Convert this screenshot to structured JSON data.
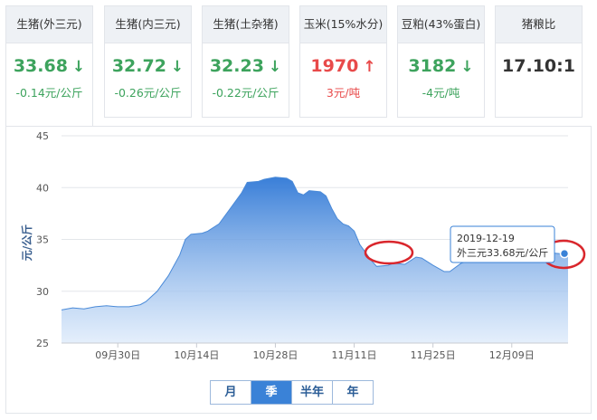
{
  "cards": [
    {
      "title": "生猪(外三元)",
      "value": "33.68",
      "arrow": "↓",
      "change": "-0.14元/公斤",
      "trend": "down"
    },
    {
      "title": "生猪(内三元)",
      "value": "32.72",
      "arrow": "↓",
      "change": "-0.26元/公斤",
      "trend": "down"
    },
    {
      "title": "生猪(土杂猪)",
      "value": "32.23",
      "arrow": "↓",
      "change": "-0.22元/公斤",
      "trend": "down"
    },
    {
      "title": "玉米(15%水分)",
      "value": "1970",
      "arrow": "↑",
      "change": "3元/吨",
      "trend": "up"
    },
    {
      "title": "豆粕(43%蛋白)",
      "value": "3182",
      "arrow": "↓",
      "change": "-4元/吨",
      "trend": "down"
    },
    {
      "title": "猪粮比",
      "value": "17.10:1",
      "arrow": "",
      "change": "",
      "trend": "flat"
    }
  ],
  "colors": {
    "up": "#e84a4a",
    "down": "#3da35d",
    "series": "#3a82d7",
    "annotation": "#d9262c"
  },
  "range_buttons": [
    "月",
    "季",
    "半年",
    "年"
  ],
  "selected_range": "季",
  "tooltip": {
    "date": "2019-12-19",
    "text": "外三元33.68元/公斤"
  },
  "chart_data": {
    "type": "area",
    "ylabel": "元/公斤",
    "ylim": [
      25,
      45
    ],
    "yticks": [
      25,
      30,
      35,
      40,
      45
    ],
    "xtick_labels": [
      {
        "label": "09月30日",
        "day": 10
      },
      {
        "label": "10月14日",
        "day": 24
      },
      {
        "label": "10月28日",
        "day": 38
      },
      {
        "label": "11月11日",
        "day": 52
      },
      {
        "label": "11月25日",
        "day": 66
      },
      {
        "label": "12月09日",
        "day": 80
      }
    ],
    "x_domain": [
      0,
      90
    ],
    "grid": true,
    "series": [
      {
        "values": [
          [
            0,
            28.2
          ],
          [
            2,
            28.4
          ],
          [
            4,
            28.3
          ],
          [
            6,
            28.5
          ],
          [
            8,
            28.6
          ],
          [
            10,
            28.5
          ],
          [
            12,
            28.5
          ],
          [
            14,
            28.7
          ],
          [
            15,
            29.0
          ],
          [
            17,
            30.0
          ],
          [
            19,
            31.5
          ],
          [
            21,
            33.5
          ],
          [
            22,
            35.0
          ],
          [
            23,
            35.5
          ],
          [
            25,
            35.6
          ],
          [
            26,
            35.8
          ],
          [
            28,
            36.5
          ],
          [
            30,
            38.0
          ],
          [
            32,
            39.5
          ],
          [
            33,
            40.5
          ],
          [
            35,
            40.6
          ],
          [
            36,
            40.8
          ],
          [
            38,
            41.0
          ],
          [
            40,
            40.9
          ],
          [
            41,
            40.6
          ],
          [
            42,
            39.5
          ],
          [
            43,
            39.3
          ],
          [
            44,
            39.7
          ],
          [
            46,
            39.6
          ],
          [
            47,
            39.2
          ],
          [
            48,
            38.0
          ],
          [
            49,
            37.0
          ],
          [
            50,
            36.5
          ],
          [
            51,
            36.3
          ],
          [
            52,
            35.8
          ],
          [
            53,
            34.5
          ],
          [
            55,
            33.0
          ],
          [
            56,
            32.4
          ],
          [
            58,
            32.5
          ],
          [
            59,
            32.7
          ],
          [
            61,
            32.6
          ],
          [
            63,
            33.3
          ],
          [
            64,
            33.2
          ],
          [
            66,
            32.5
          ],
          [
            68,
            31.9
          ],
          [
            69,
            31.9
          ],
          [
            71,
            32.7
          ],
          [
            73,
            33.0
          ],
          [
            75,
            33.3
          ],
          [
            77,
            33.6
          ],
          [
            79,
            33.9
          ],
          [
            81,
            34.2
          ],
          [
            83,
            34.3
          ],
          [
            85,
            34.0
          ],
          [
            87,
            33.7
          ],
          [
            89,
            33.6
          ],
          [
            90,
            33.68
          ]
        ]
      }
    ]
  }
}
